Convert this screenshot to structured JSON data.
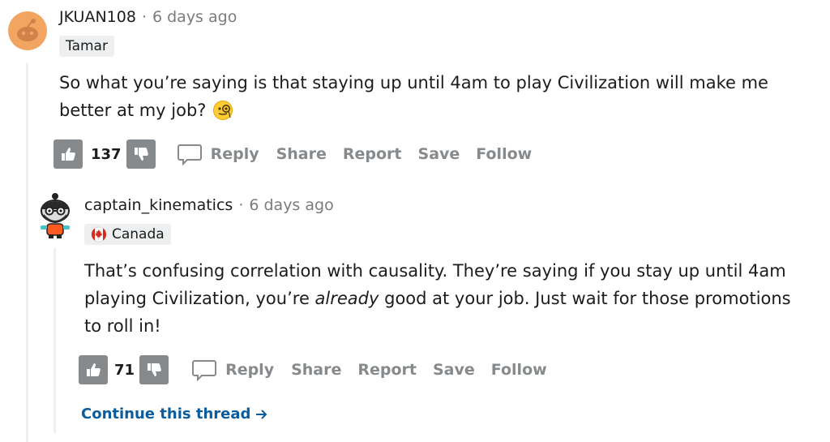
{
  "colors": {
    "vote_button": "#878a8c",
    "action_text": "#878a8c",
    "continue_link": "#0b5c9c",
    "flair_bg": "#edeff1",
    "avatar1": "#f2a561",
    "flag_red": "#d52b1e"
  },
  "comment1": {
    "username": "JKUAN108",
    "separator": "·",
    "time": "6 days ago",
    "flair": "Tamar",
    "body_line1": "So what you’re saying is that staying up until 4am to play Civilization will make me",
    "body_line2": "better at my job?",
    "emoji_icon": "face-with-monocle-icon",
    "score": "137",
    "actions": {
      "reply": "Reply",
      "share": "Share",
      "report": "Report",
      "save": "Save",
      "follow": "Follow"
    }
  },
  "comment2": {
    "username": "captain_kinematics",
    "separator": "·",
    "time": "6 days ago",
    "flair": "Canada",
    "flair_icon": "canada-flag-icon",
    "body_line1": "That’s confusing correlation with causality. They’re saying if you stay up until 4am",
    "body_line2_a": "playing Civilization, you’re ",
    "body_line2_em": "already",
    "body_line2_b": " good at your job. Just wait for those promotions",
    "body_line3": "to roll in!",
    "score": "71",
    "actions": {
      "reply": "Reply",
      "share": "Share",
      "report": "Report",
      "save": "Save",
      "follow": "Follow"
    }
  },
  "continue_thread": "Continue this thread"
}
